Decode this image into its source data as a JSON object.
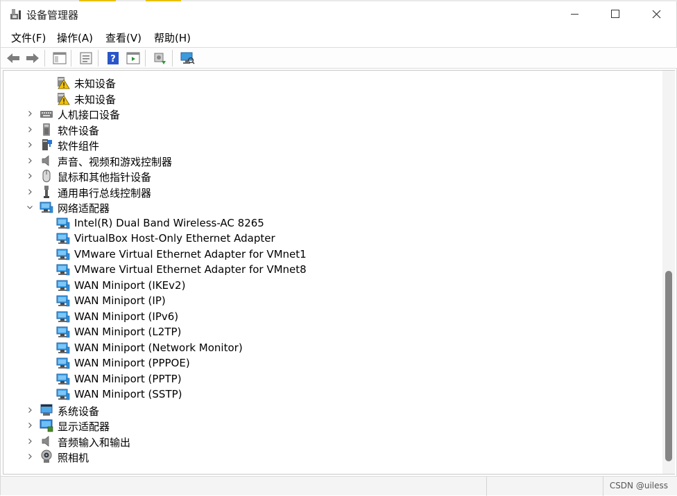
{
  "window": {
    "title": "设备管理器",
    "minimize_glyph": "—",
    "maximize_glyph": "☐",
    "close_glyph": "✕"
  },
  "menu": [
    "文件(F)",
    "操作(A)",
    "查看(V)",
    "帮助(H)"
  ],
  "toolbar": {
    "items": [
      "back-icon",
      "forward-icon",
      "show-hide-console-tree-icon",
      "properties-icon",
      "help-icon",
      "action-pane-icon",
      "update-driver-icon",
      "scan-hardware-icon"
    ]
  },
  "tree": {
    "rows": [
      {
        "label": "未知设备",
        "icon": "unknown-device-icon",
        "level": 1,
        "expander": "none"
      },
      {
        "label": "未知设备",
        "icon": "unknown-device-icon",
        "level": 1,
        "expander": "none"
      },
      {
        "label": "人机接口设备",
        "icon": "hid-icon",
        "level": 0,
        "expander": "collapsed"
      },
      {
        "label": "软件设备",
        "icon": "software-device-icon",
        "level": 0,
        "expander": "collapsed"
      },
      {
        "label": "软件组件",
        "icon": "software-component-icon",
        "level": 0,
        "expander": "collapsed"
      },
      {
        "label": "声音、视频和游戏控制器",
        "icon": "speaker-icon",
        "level": 0,
        "expander": "collapsed"
      },
      {
        "label": "鼠标和其他指针设备",
        "icon": "mouse-icon",
        "level": 0,
        "expander": "collapsed"
      },
      {
        "label": "通用串行总线控制器",
        "icon": "usb-icon",
        "level": 0,
        "expander": "collapsed"
      },
      {
        "label": "网络适配器",
        "icon": "network-adapter-icon",
        "level": 0,
        "expander": "expanded"
      },
      {
        "label": "Intel(R) Dual Band Wireless-AC 8265",
        "icon": "network-adapter-icon",
        "level": 1,
        "expander": "none"
      },
      {
        "label": "VirtualBox Host-Only Ethernet Adapter",
        "icon": "network-adapter-icon",
        "level": 1,
        "expander": "none"
      },
      {
        "label": "VMware Virtual Ethernet Adapter for VMnet1",
        "icon": "network-adapter-icon",
        "level": 1,
        "expander": "none"
      },
      {
        "label": "VMware Virtual Ethernet Adapter for VMnet8",
        "icon": "network-adapter-icon",
        "level": 1,
        "expander": "none"
      },
      {
        "label": "WAN Miniport (IKEv2)",
        "icon": "network-adapter-icon",
        "level": 1,
        "expander": "none"
      },
      {
        "label": "WAN Miniport (IP)",
        "icon": "network-adapter-icon",
        "level": 1,
        "expander": "none"
      },
      {
        "label": "WAN Miniport (IPv6)",
        "icon": "network-adapter-icon",
        "level": 1,
        "expander": "none"
      },
      {
        "label": "WAN Miniport (L2TP)",
        "icon": "network-adapter-icon",
        "level": 1,
        "expander": "none"
      },
      {
        "label": "WAN Miniport (Network Monitor)",
        "icon": "network-adapter-icon",
        "level": 1,
        "expander": "none"
      },
      {
        "label": "WAN Miniport (PPPOE)",
        "icon": "network-adapter-icon",
        "level": 1,
        "expander": "none"
      },
      {
        "label": "WAN Miniport (PPTP)",
        "icon": "network-adapter-icon",
        "level": 1,
        "expander": "none"
      },
      {
        "label": "WAN Miniport (SSTP)",
        "icon": "network-adapter-icon",
        "level": 1,
        "expander": "none"
      },
      {
        "label": "系统设备",
        "icon": "system-device-icon",
        "level": 0,
        "expander": "collapsed"
      },
      {
        "label": "显示适配器",
        "icon": "display-adapter-icon",
        "level": 0,
        "expander": "collapsed"
      },
      {
        "label": "音频输入和输出",
        "icon": "speaker-icon",
        "level": 0,
        "expander": "collapsed"
      },
      {
        "label": "照相机",
        "icon": "camera-icon",
        "level": 0,
        "expander": "collapsed"
      }
    ]
  },
  "status": {
    "watermark": "CSDN @uiless"
  },
  "colors": {
    "accent_blue": "#1e88d8",
    "warning_yellow": "#f2c200",
    "scroll_thumb": "#858585"
  }
}
